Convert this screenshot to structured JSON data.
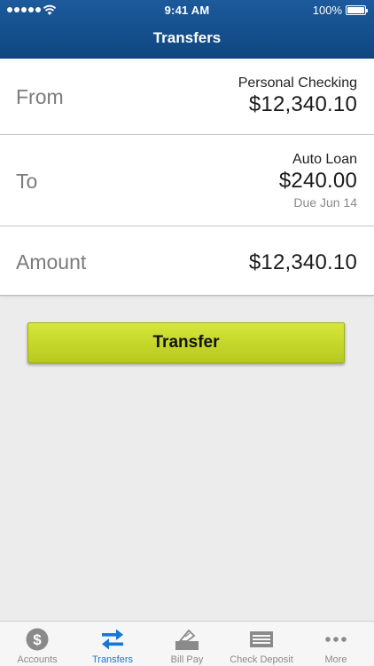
{
  "status_bar": {
    "time": "9:41 AM",
    "battery": "100%"
  },
  "nav": {
    "title": "Transfers"
  },
  "from": {
    "label": "From",
    "account": "Personal Checking",
    "amount": "$12,340.10"
  },
  "to": {
    "label": "To",
    "account": "Auto Loan",
    "amount": "$240.00",
    "due": "Due Jun 14"
  },
  "amount": {
    "label": "Amount",
    "value": "$12,340.10"
  },
  "transfer_button": {
    "label": "Transfer"
  },
  "tabs": [
    {
      "label": "Accounts",
      "icon": "dollar-circle-icon"
    },
    {
      "label": "Transfers",
      "icon": "transfer-arrows-icon"
    },
    {
      "label": "Bill Pay",
      "icon": "bill-pay-icon"
    },
    {
      "label": "Check Deposit",
      "icon": "check-deposit-icon"
    },
    {
      "label": "More",
      "icon": "more-dots-icon"
    }
  ],
  "colors": {
    "header": "#1c5a9c",
    "button": "#c8d92c",
    "active_tab": "#1777d6",
    "inactive_tab": "#8a8a8a"
  }
}
